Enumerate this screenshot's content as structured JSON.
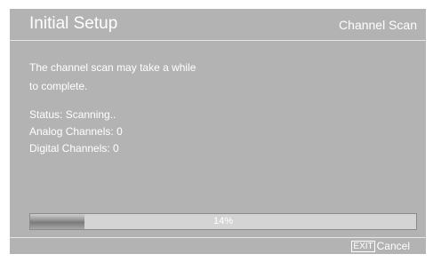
{
  "header": {
    "title": "Initial Setup",
    "subtitle": "Channel Scan"
  },
  "message": {
    "line1": "The channel scan may take a while",
    "line2": "to complete."
  },
  "status": {
    "status_text": "Status: Scanning..",
    "analog_text": "Analog Channels: 0",
    "digital_text": "Digital Channels: 0"
  },
  "progress": {
    "percent": 14,
    "label": "14%"
  },
  "footer": {
    "exit_key": "EXIT",
    "cancel_label": "Cancel"
  },
  "colors": {
    "background": "#b3b3b3",
    "text": "#ffffff",
    "progress_track": "#d4d4d4"
  }
}
